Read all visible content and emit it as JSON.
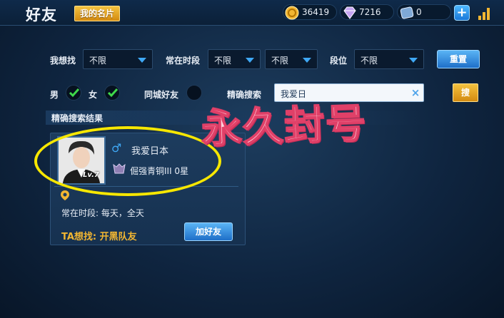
{
  "header": {
    "title": "好友",
    "my_card_label": "我的名片",
    "gold": "36419",
    "diamonds": "7216",
    "coupons": "0",
    "add_label": "+"
  },
  "filters": {
    "looking_for_label": "我想找",
    "looking_for_value": "不限",
    "online_time_label": "常在时段",
    "online_time_value1": "不限",
    "online_time_value2": "不限",
    "rank_label": "段位",
    "rank_value": "不限",
    "reset_label": "重置",
    "male_label": "男",
    "female_label": "女",
    "same_city_label": "同城好友",
    "exact_search_label": "精确搜索",
    "search_value": "我爱日",
    "clear_icon": "×",
    "search_button_label": "搜"
  },
  "results": {
    "section_title": "精确搜索结果",
    "player": {
      "gender_icon": "♂",
      "name": "我爱日本",
      "level_badge": "Lv.7",
      "rank": "倔强青铜III 0星",
      "online_time": "常在时段: 每天，全天",
      "wants": "TA想找: 开黑队友",
      "add_friend_label": "加好友"
    }
  },
  "overlay": {
    "stamp_text": "永久封号"
  },
  "colors": {
    "accent_gold": "#f2b632",
    "accent_blue": "#3fa8f5",
    "stamp_pink": "#e04068",
    "highlight_yellow": "#f7e700"
  }
}
